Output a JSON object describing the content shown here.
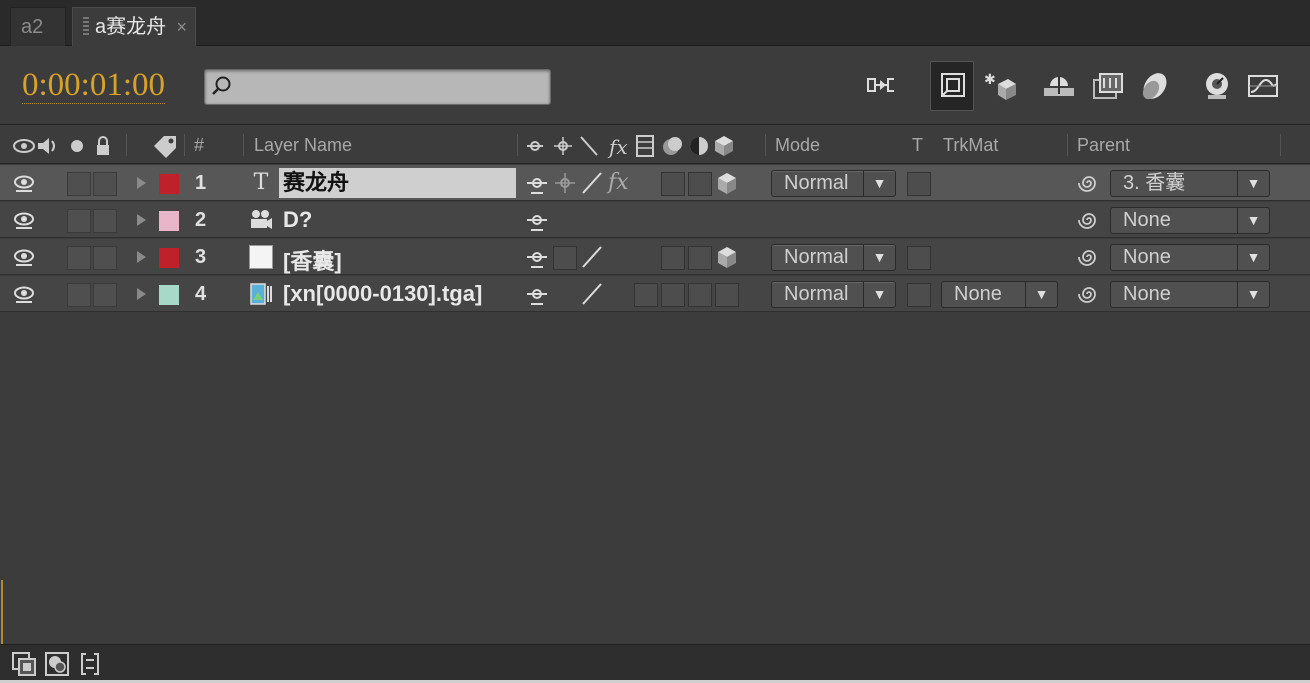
{
  "tabs": [
    {
      "label": "a2",
      "active": false
    },
    {
      "label": "a赛龙舟",
      "active": true,
      "close": "×"
    }
  ],
  "toolbar": {
    "timecode": "0:00:01:00",
    "search_value": "",
    "tools": [
      "comp-mini-flowchart-icon",
      "draft-3d-icon",
      "hide-shy-layers-icon",
      "frame-blending-icon",
      "motion-blur-icon",
      "brainstorm-icon",
      "graph-editor-icon"
    ]
  },
  "columns": {
    "layer_name": "Layer Name",
    "num": "#",
    "mode": "Mode",
    "t": "T",
    "trkmat": "TrkMat",
    "parent": "Parent"
  },
  "layers": [
    {
      "num": "1",
      "name": "赛龙舟",
      "type": "text",
      "label_color": "#c0202a",
      "mode": "Normal",
      "parent": "3. 香囊",
      "selected": true,
      "editing": true
    },
    {
      "num": "2",
      "name": "D?",
      "type": "camera",
      "label_color": "#e8b6c8",
      "mode": "",
      "parent": "None"
    },
    {
      "num": "3",
      "name": "[香囊]",
      "type": "solid",
      "label_color": "#c0202a",
      "mode": "Normal",
      "parent": "None"
    },
    {
      "num": "4",
      "name": "[xn[0000-0130].tga]",
      "type": "footage",
      "label_color": "#a8d8c8",
      "mode": "Normal",
      "trkmat": "None",
      "parent": "None"
    }
  ],
  "glyphs": {
    "dropdown_arrow": "▼",
    "text_layer_icon": "T"
  }
}
